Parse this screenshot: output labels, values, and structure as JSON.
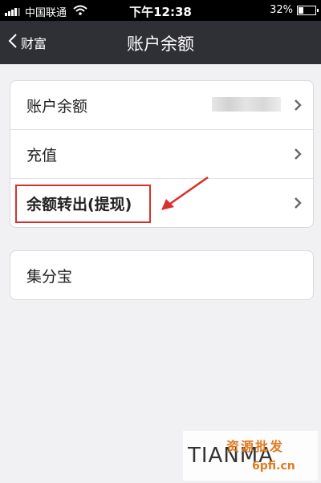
{
  "status_bar": {
    "carrier": "中国联通",
    "time": "下午12:38",
    "battery": "32%",
    "battery_level": 0.32
  },
  "nav": {
    "back_label": "财富",
    "title": "账户余额"
  },
  "menu": {
    "group1": [
      {
        "label": "账户余额"
      },
      {
        "label": "充值"
      },
      {
        "label": "余额转出(提现)"
      }
    ],
    "group2": [
      {
        "label": "集分宝"
      }
    ]
  },
  "watermark": {
    "text": "TIANMA",
    "brand_cn": "资源批发",
    "url": "6pfi.cn"
  },
  "colors": {
    "nav_bg": "#2f2f36",
    "page_bg": "#f1f1f3",
    "highlight": "#d9302b"
  }
}
